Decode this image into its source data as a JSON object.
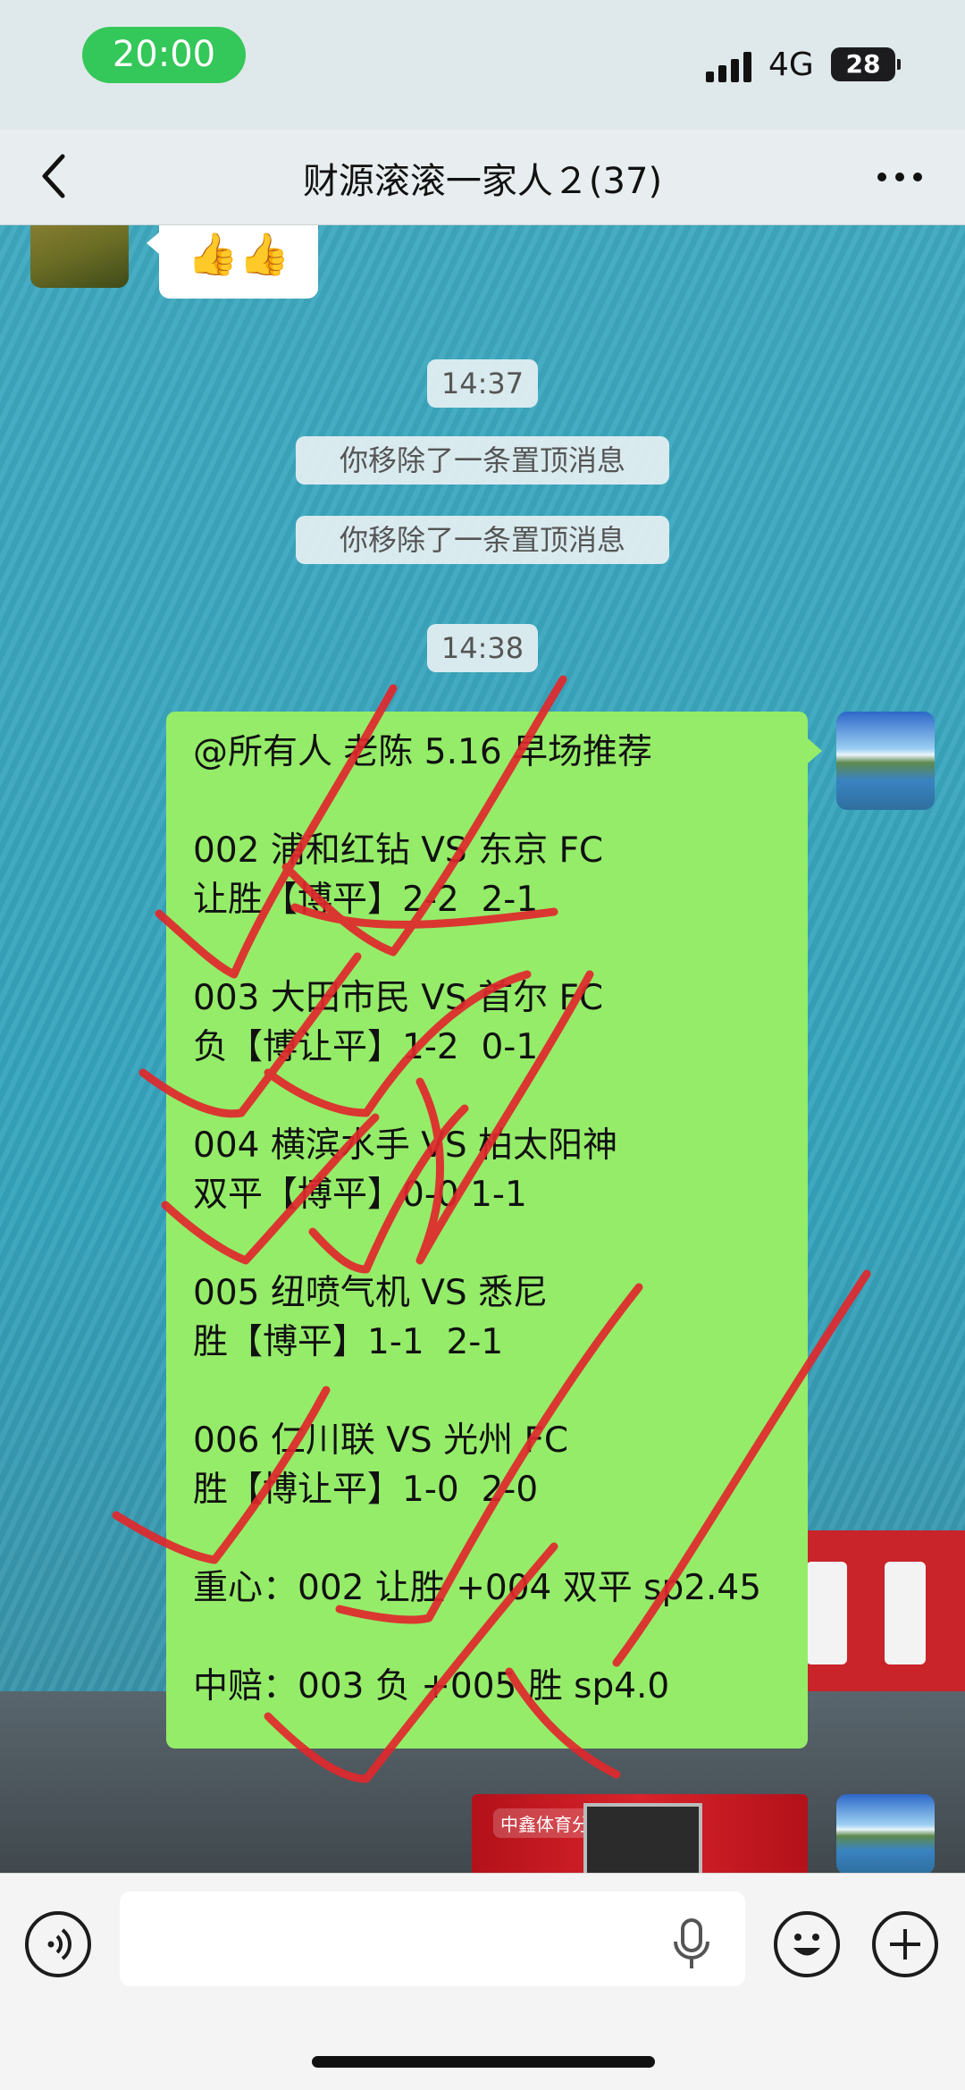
{
  "status_bar": {
    "time": "20:00",
    "network": "4G",
    "battery": "28"
  },
  "nav": {
    "title": "财源滚滚一家人２(37)"
  },
  "chat": {
    "first_message": {
      "text": "👍👍"
    },
    "timestamps": [
      "14:37",
      "14:38"
    ],
    "system_notices": [
      "你移除了一条置顶消息",
      "你移除了一条置顶消息"
    ],
    "recommendation": {
      "lines": [
        "@所有人 老陈 5.16 早场推荐",
        "",
        "002 浦和红钻 VS 东京 FC",
        "让胜【博平】2-2  2-1",
        "",
        "003 大田市民 VS 首尔 FC",
        "负【博让平】1-2  0-1",
        "",
        "004 横滨水手 VS 柏太阳神",
        "双平【博平】0-0 1-1",
        "",
        "005 纽喷气机 VS 悉尼",
        "胜【博平】1-1  2-1",
        "",
        "006 仁川联 VS 光州 FC",
        "胜【博让平】1-0  2-0",
        "",
        "重心：002 让胜 +004 双平 sp2.45",
        "",
        "中赔：003 负 +005 胜 sp4.0"
      ]
    },
    "image_message": {
      "logo_text": "中鑫体育分"
    }
  },
  "input_bar": {
    "placeholder": ""
  },
  "icons": [
    "back-icon",
    "more-icon",
    "voice-icon",
    "mic-icon",
    "emoji-icon",
    "plus-icon"
  ],
  "colors": {
    "sent_bubble": "#95ec69",
    "time_pill": "#34c759",
    "annotation_ink": "#e0282d"
  }
}
